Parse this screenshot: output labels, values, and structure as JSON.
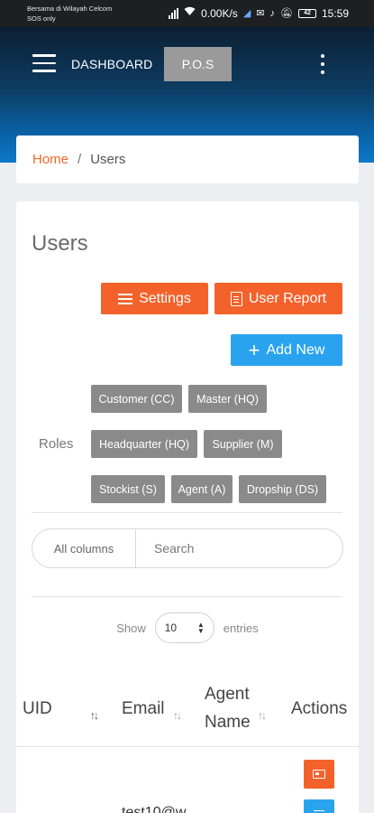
{
  "status_bar": {
    "carrier_line1": "Bersama di Wilayah Celcom",
    "carrier_line2": "SOS only",
    "net_speed": "0.00K/s",
    "battery": "42",
    "time": "15:59"
  },
  "header": {
    "title": "DASHBOARD",
    "pos_label": "P.O.S"
  },
  "breadcrumb": {
    "home": "Home",
    "separator": "/",
    "current": "Users"
  },
  "page": {
    "title": "Users",
    "settings_label": "Settings",
    "report_label": "User Report",
    "add_label": "Add New"
  },
  "roles": {
    "label": "Roles",
    "chips": [
      "Customer (CC)",
      "Master (HQ)",
      "Headquarter (HQ)",
      "Supplier (M)",
      "Stockist (S)",
      "Agent (A)",
      "Dropship (DS)"
    ]
  },
  "search": {
    "column_select": "All columns",
    "placeholder": "Search"
  },
  "entries": {
    "show_label": "Show",
    "value": "10",
    "entries_label": "entries"
  },
  "table": {
    "headers": [
      "UID",
      "Email",
      "Agent",
      "Name",
      "Actions"
    ],
    "row_email": "test10@w"
  },
  "colors": {
    "accent_orange": "#f4622b",
    "accent_blue": "#2aa3ee",
    "chip_gray": "#8a8a8a",
    "header_blue": "#0d79c9"
  }
}
